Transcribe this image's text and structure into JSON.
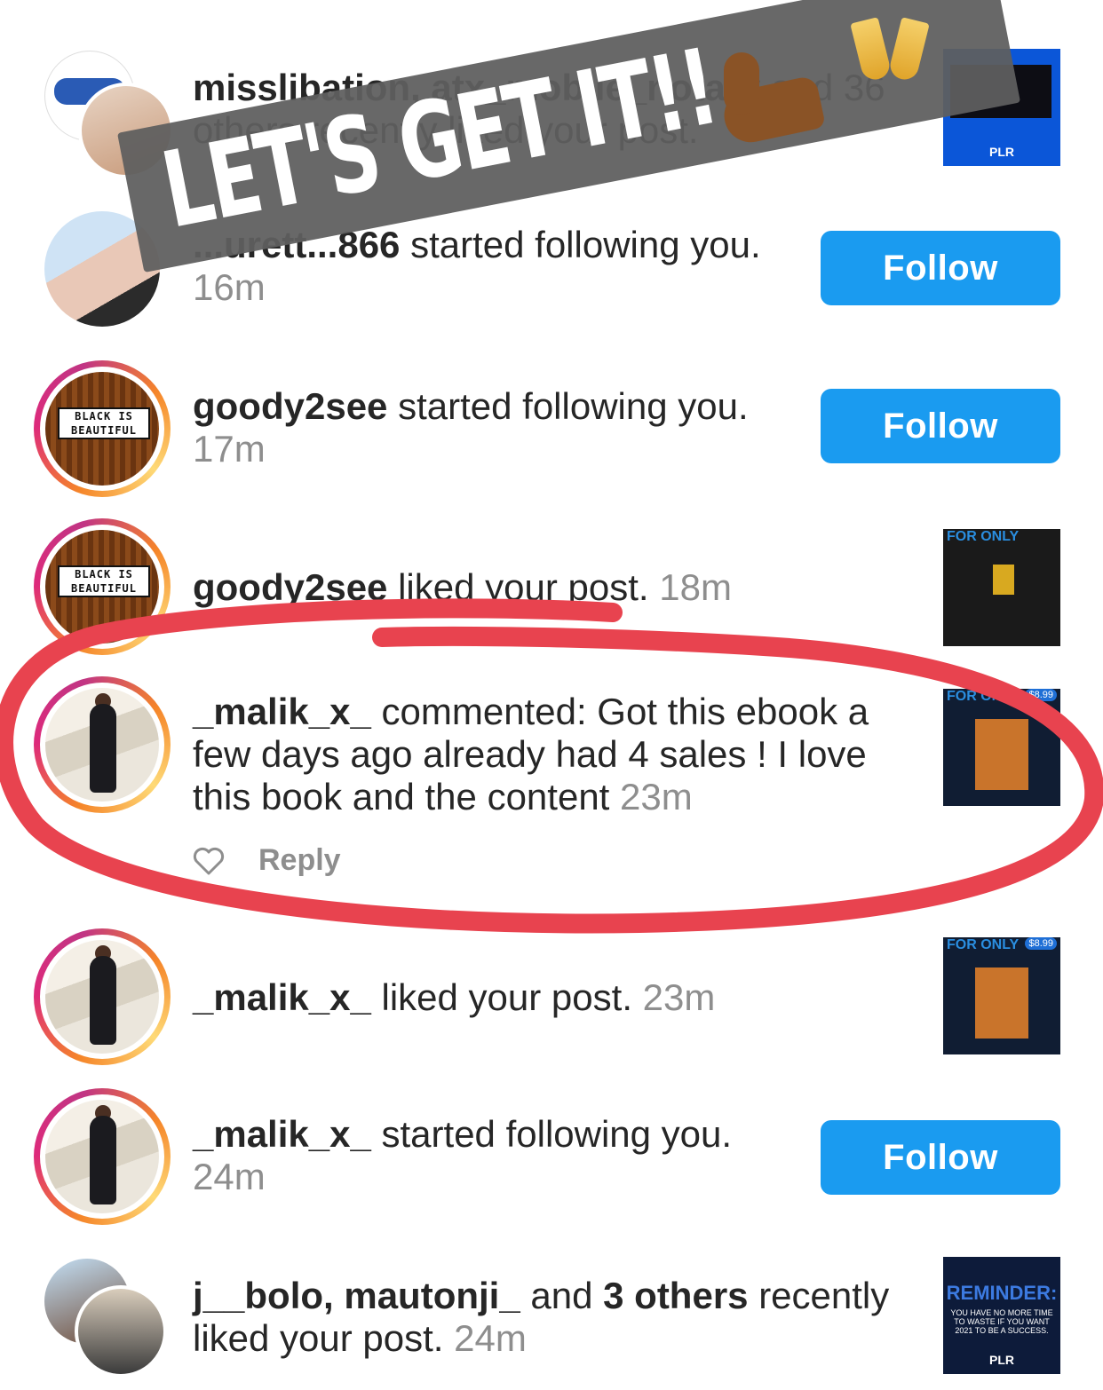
{
  "banner": {
    "text": "LET'S GET IT!!"
  },
  "notifications": [
    {
      "user": "misslibation, atx_mobile_notary",
      "action": " and 36 others recently liked your post.",
      "time": "",
      "thumb": "PLR"
    },
    {
      "user": "...urett...866",
      "action": " started following you.",
      "time": "16m",
      "button": "Follow"
    },
    {
      "user": "goody2see",
      "action": " started following you.",
      "time": "17m",
      "button": "Follow",
      "avatar_text": "BLACK IS BEAUTIFUL"
    },
    {
      "user": "goody2see",
      "action": " liked your post.",
      "time": "18m",
      "avatar_text": "BLACK IS BEAUTIFUL",
      "thumb_label": "FOR ONLY"
    },
    {
      "user": "_malik_x_",
      "action": " commented: Got this ebook a few days ago already had 4 sales ! I love this book and the content",
      "time": "23m",
      "reply_label": "Reply",
      "thumb_label": "FOR ONLY",
      "thumb_price": "$8.99"
    },
    {
      "user": "_malik_x_",
      "action": " liked your post.",
      "time": "23m",
      "thumb_label": "FOR ONLY",
      "thumb_price": "$8.99"
    },
    {
      "user": "_malik_x_",
      "action": " started following you.",
      "time": "24m",
      "button": "Follow"
    },
    {
      "user": "j__bolo, mautonji_",
      "action_mid": " and ",
      "others": "3 others",
      "action": " recently liked your post.",
      "time": "24m",
      "thumb_title": "REMINDER:",
      "thumb_sub": "YOU HAVE NO MORE TIME TO WASTE IF YOU WANT 2021 TO BE A SUCCESS.",
      "thumb_brand": "PLR"
    }
  ],
  "colors": {
    "follow_blue": "#1a9bf0",
    "circle_red": "#e8434f",
    "time_gray": "#8e8e8e"
  }
}
